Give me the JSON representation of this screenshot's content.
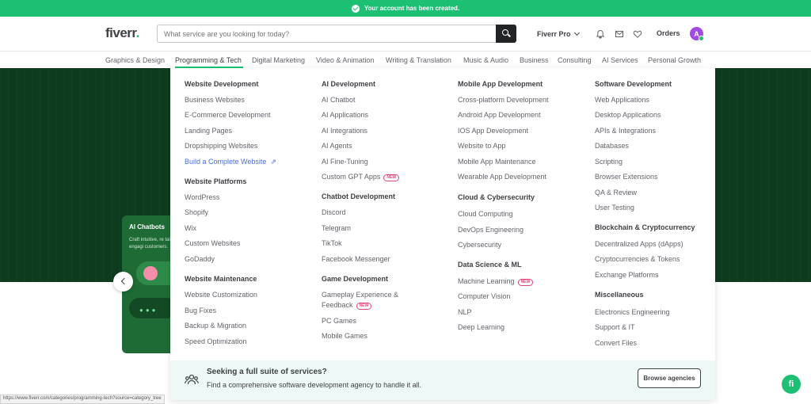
{
  "banner": {
    "text": "Your account has been created."
  },
  "header": {
    "logo": "fiverr",
    "logo_dot": ".",
    "search_placeholder": "What service are you looking for today?",
    "fiverr_pro": "Fiverr Pro",
    "orders": "Orders",
    "avatar_initial": "A"
  },
  "categories": [
    "Graphics & Design",
    "Programming & Tech",
    "Digital Marketing",
    "Video & Animation",
    "Writing & Translation",
    "Music & Audio",
    "Business",
    "Consulting",
    "AI Services",
    "Personal Growth"
  ],
  "menu": {
    "col1": {
      "website_development": {
        "title": "Website Development",
        "items": [
          "Business Websites",
          "E-Commerce Development",
          "Landing Pages",
          "Dropshipping Websites"
        ],
        "link": "Build a Complete Website"
      },
      "website_platforms": {
        "title": "Website Platforms",
        "items": [
          "WordPress",
          "Shopify",
          "Wix",
          "Custom Websites",
          "GoDaddy"
        ]
      },
      "website_maintenance": {
        "title": "Website Maintenance",
        "items": [
          "Website Customization",
          "Bug Fixes",
          "Backup & Migration",
          "Speed Optimization"
        ]
      }
    },
    "col2": {
      "ai_development": {
        "title": "AI Development",
        "items": [
          "AI Chatbot",
          "AI Applications",
          "AI Integrations",
          "AI Agents",
          "AI Fine-Tuning",
          "Custom GPT Apps"
        ]
      },
      "chatbot_development": {
        "title": "Chatbot Development",
        "items": [
          "Discord",
          "Telegram",
          "TikTok",
          "Facebook Messenger"
        ]
      },
      "game_development": {
        "title": "Game Development",
        "items": [
          "Gameplay Experience &",
          "Feedback",
          "PC Games",
          "Mobile Games"
        ]
      }
    },
    "col3": {
      "mobile_app": {
        "title": "Mobile App Development",
        "items": [
          "Cross-platform Development",
          "Android App Development",
          "IOS App Development",
          "Website to App",
          "Mobile App Maintenance",
          "Wearable App Development"
        ]
      },
      "cloud": {
        "title": "Cloud & Cybersecurity",
        "items": [
          "Cloud Computing",
          "DevOps Engineering",
          "Cybersecurity"
        ]
      },
      "data_science": {
        "title": "Data Science & ML",
        "items": [
          "Machine Learning",
          "Computer Vision",
          "NLP",
          "Deep Learning"
        ]
      }
    },
    "col4": {
      "software_development": {
        "title": "Software Development",
        "items": [
          "Web Applications",
          "Desktop Applications",
          "APIs & Integrations",
          "Databases",
          "Scripting",
          "Browser Extensions",
          "QA & Review",
          "User Testing"
        ]
      },
      "blockchain": {
        "title": "Blockchain & Cryptocurrency",
        "items": [
          "Decentralized Apps (dApps)",
          "Cryptocurrencies & Tokens",
          "Exchange Platforms"
        ]
      },
      "misc": {
        "title": "Miscellaneous",
        "items": [
          "Electronics Engineering",
          "Support & IT",
          "Convert Files"
        ]
      }
    },
    "new_badge": "NEW"
  },
  "agency": {
    "title": "Seeking a full suite of services?",
    "desc": "Find a comprehensive software development agency to handle it all.",
    "button": "Browse agencies"
  },
  "hero_card": {
    "title": "AI Chatbots",
    "desc": "Craft intuitive, re tailored to engagi customers."
  },
  "statusbar": "https://www.fiverr.com/categories/programming-tech?source=category_tree",
  "help_label": "fi",
  "colors": {
    "brand_green": "#1dbf73",
    "dark_text": "#404145",
    "hero_bg": "#0c3b1e",
    "link_blue": "#446ee7",
    "badge_pink": "#e0457b"
  }
}
